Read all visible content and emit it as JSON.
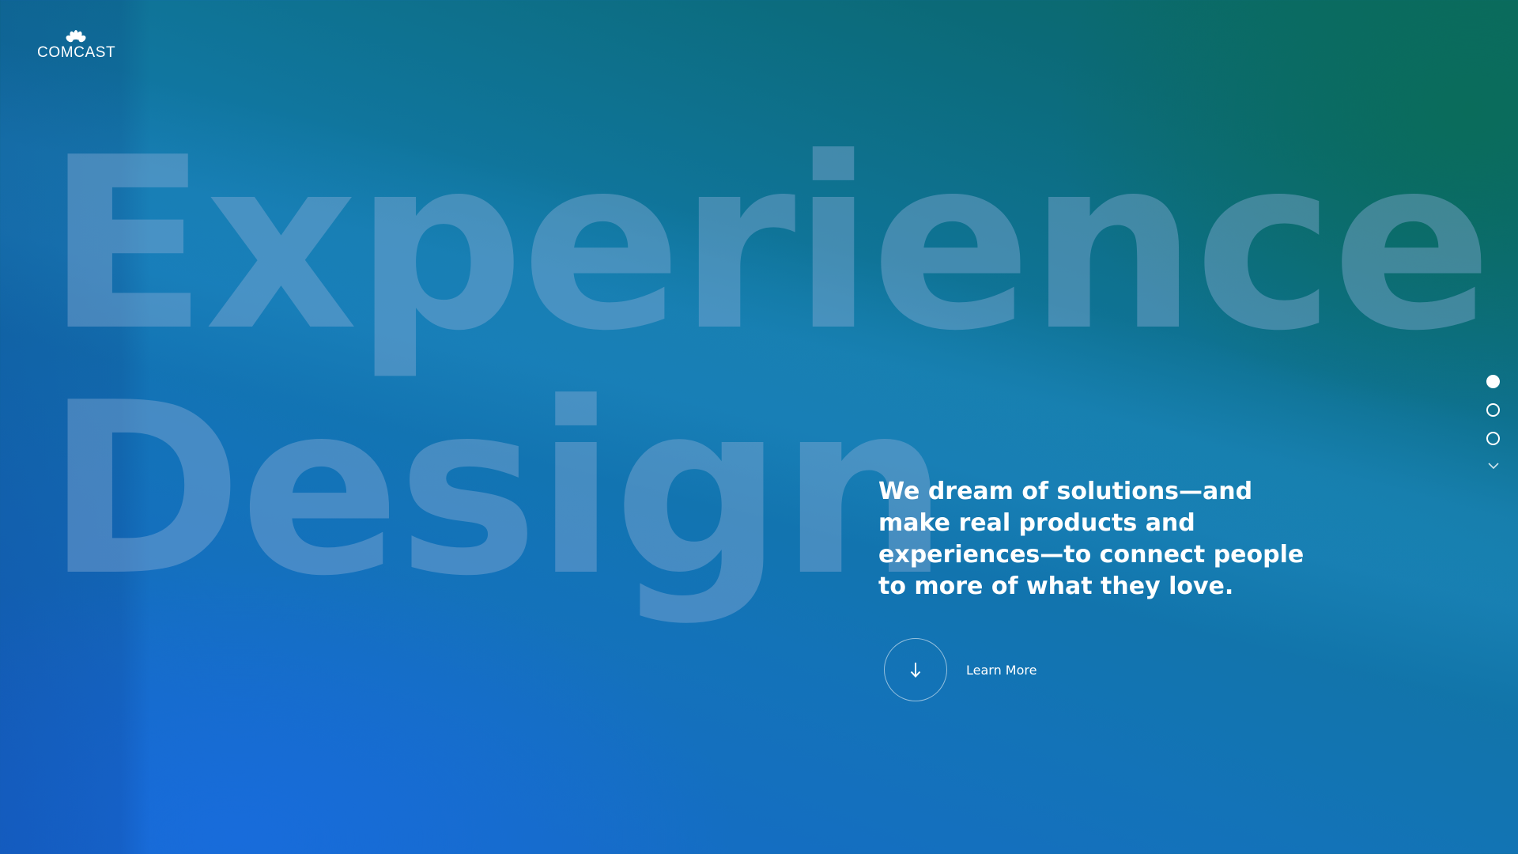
{
  "brand": {
    "name": "COMCAST"
  },
  "hero": {
    "line1": "Experience",
    "line2": "Design",
    "tagline": "We dream of solutions—and make real products and experiences—to connect people to more of what they love."
  },
  "cta": {
    "label": "Learn More",
    "icon": "arrow-down-icon"
  },
  "pager": {
    "count": 3,
    "active_index": 0,
    "next_icon": "chevron-down-icon"
  },
  "colors": {
    "background_blue": "#1667cf",
    "background_teal": "#0a6a5e",
    "text": "#ffffff",
    "hero_word": "#8cafd7"
  }
}
